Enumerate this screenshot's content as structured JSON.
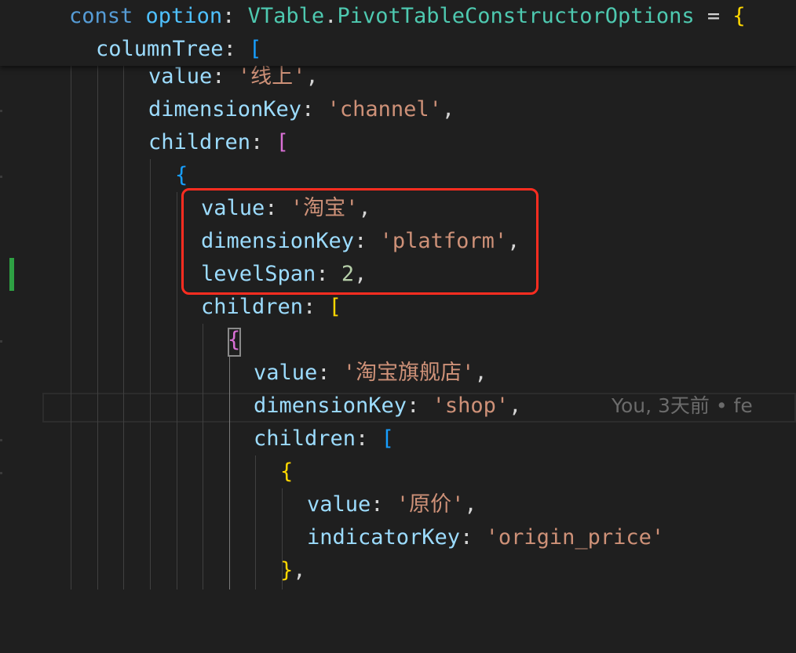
{
  "colors": {
    "background": "#1f1f1f",
    "keyword": "#569cd6",
    "property": "#9cdcfe",
    "type": "#4ec9b0",
    "string": "#ce9178",
    "number": "#b5cea8",
    "bracket_gold": "#ffd700",
    "bracket_magenta": "#da70d6",
    "bracket_blue": "#179fff",
    "annotation_box": "#ff2d20",
    "git_added": "#2ea043"
  },
  "icons": {
    "git_change": "git-added-bar"
  },
  "sticky": {
    "line1": {
      "keyword": "const",
      "var": "option",
      "colon": ":",
      "namespace": "VTable",
      "dot": ".",
      "type_name": "PivotTableConstructorOptions",
      "eq": "=",
      "brace": "{"
    },
    "line2": {
      "prop": "columnTree",
      "colon": ":",
      "bracket": "["
    }
  },
  "code": {
    "l1": {
      "prop": "value",
      "colon": ":",
      "str": "'线上'",
      "comma": ","
    },
    "l2": {
      "prop": "dimensionKey",
      "colon": ":",
      "str": "'channel'",
      "comma": ","
    },
    "l3": {
      "prop": "children",
      "colon": ":",
      "bracket": "["
    },
    "l4": {
      "brace": "{"
    },
    "l5": {
      "prop": "value",
      "colon": ":",
      "str": "'淘宝'",
      "comma": ","
    },
    "l6": {
      "prop": "dimensionKey",
      "colon": ":",
      "str": "'platform'",
      "comma": ","
    },
    "l7": {
      "prop": "levelSpan",
      "colon": ":",
      "num": "2",
      "comma": ","
    },
    "l8": {
      "prop": "children",
      "colon": ":",
      "bracket": "["
    },
    "l9": {
      "brace": "{"
    },
    "l10": {
      "prop": "value",
      "colon": ":",
      "str": "'淘宝旗舰店'",
      "comma": ","
    },
    "l11": {
      "prop": "dimensionKey",
      "colon": ":",
      "str": "'shop'",
      "comma": ",",
      "blame": "You, 3天前 • fe"
    },
    "l12": {
      "prop": "children",
      "colon": ":",
      "bracket": "["
    },
    "l13": {
      "brace": "{"
    },
    "l14": {
      "prop": "value",
      "colon": ":",
      "str": "'原价'",
      "comma": ","
    },
    "l15": {
      "prop": "indicatorKey",
      "colon": ":",
      "str": "'origin_price'"
    },
    "l16": {
      "brace": "}",
      "comma": ","
    }
  }
}
